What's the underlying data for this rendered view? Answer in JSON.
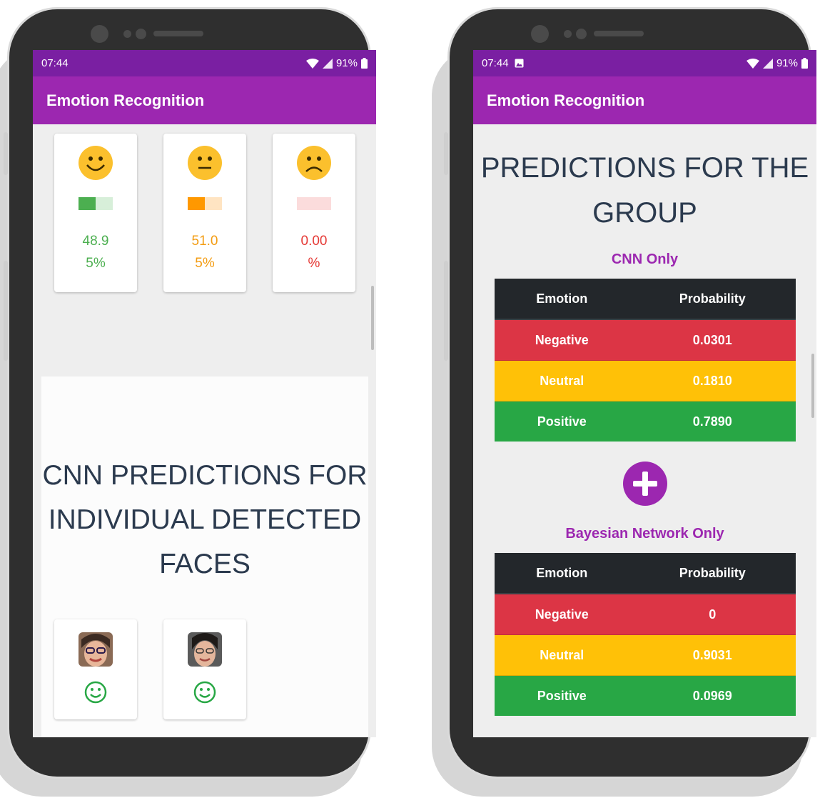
{
  "status_bar": {
    "time": "07:44",
    "battery": "91%"
  },
  "app_bar": {
    "title": "Emotion Recognition"
  },
  "left_screen": {
    "emotion_cards": [
      {
        "emotion": "positive",
        "icon": "smiling-face-icon",
        "pct_line1": "48.9",
        "pct_line2": "5%",
        "bar_fill": 0.49,
        "color": "#4caf50",
        "bar_color": "#4caf50",
        "bar_bg": "#d7efd9"
      },
      {
        "emotion": "neutral",
        "icon": "neutral-face-icon",
        "pct_line1": "51.0",
        "pct_line2": "5%",
        "bar_fill": 0.51,
        "color": "#f39c12",
        "bar_color": "#ff9800",
        "bar_bg": "#ffe4c2"
      },
      {
        "emotion": "negative",
        "icon": "sad-face-icon",
        "pct_line1": "0.00",
        "pct_line2": "%",
        "bar_fill": 0.0,
        "color": "#e53935",
        "bar_color": "#e53935",
        "bar_bg": "#fbdcdc"
      }
    ],
    "heading": "CNN PREDICTIONS FOR INDIVIDUAL DETECTED FACES",
    "face_cards": [
      {
        "photo": "face-photo-1",
        "prediction_icon": "smile-icon"
      },
      {
        "photo": "face-photo-2",
        "prediction_icon": "smile-icon"
      }
    ]
  },
  "right_screen": {
    "heading": "PREDICTIONS FOR THE GROUP",
    "cnn_subtitle": "CNN Only",
    "bayes_subtitle": "Bayesian Network Only",
    "table_headers": {
      "emotion": "Emotion",
      "probability": "Probability"
    },
    "cnn_table": [
      {
        "emotion": "Negative",
        "probability": "0.0301"
      },
      {
        "emotion": "Neutral",
        "probability": "0.1810"
      },
      {
        "emotion": "Positive",
        "probability": "0.7890"
      }
    ],
    "bayes_table": [
      {
        "emotion": "Negative",
        "probability": "0"
      },
      {
        "emotion": "Neutral",
        "probability": "0.9031"
      },
      {
        "emotion": "Positive",
        "probability": "0.0969"
      }
    ],
    "combine_icon": "plus-icon"
  },
  "colors": {
    "primary": "#9c27b0",
    "primary_dark": "#7a1fa2",
    "negative": "#dc3545",
    "neutral": "#ffc107",
    "positive": "#28a745",
    "table_header": "#23272b"
  }
}
